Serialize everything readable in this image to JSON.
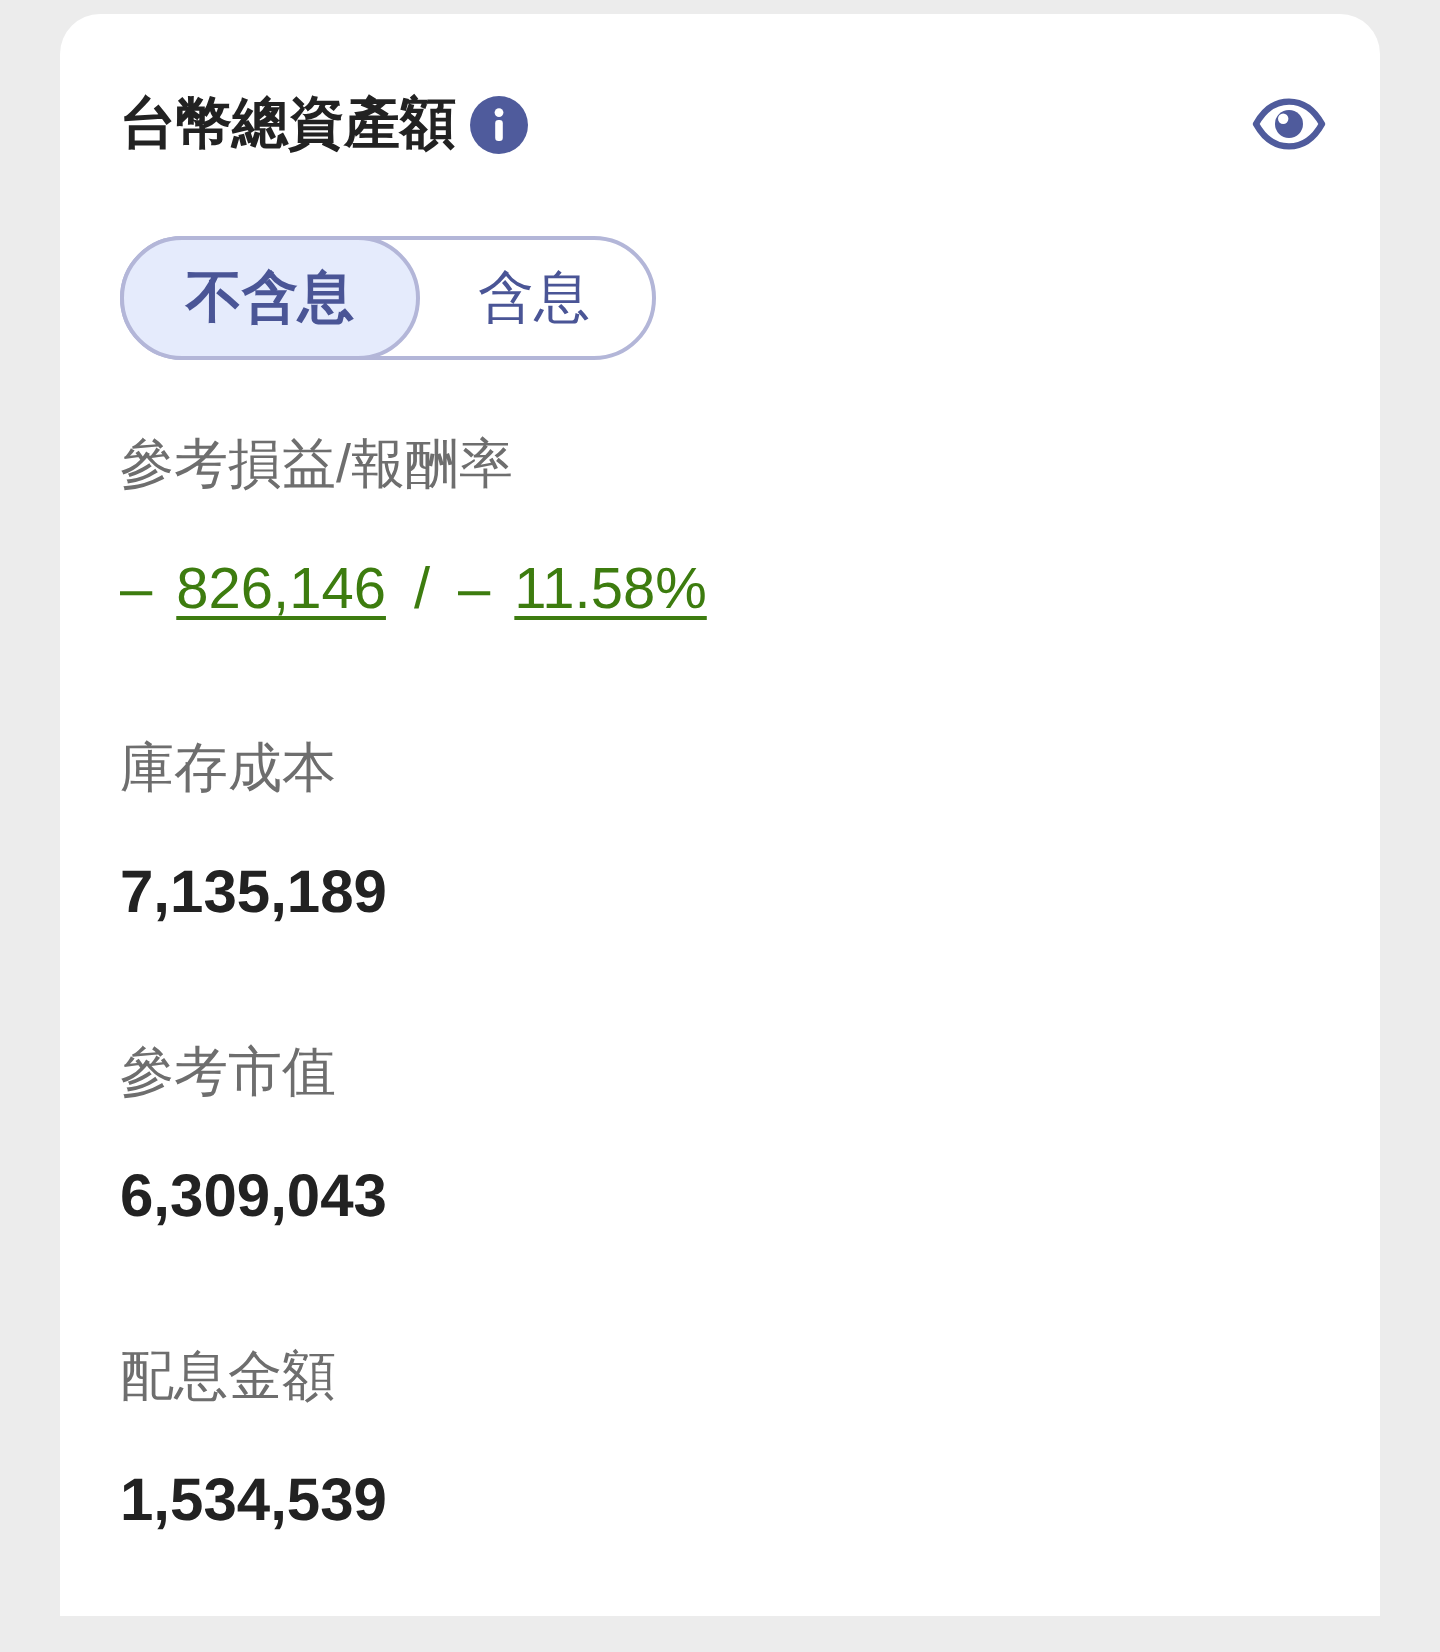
{
  "card": {
    "title": "台幣總資產額"
  },
  "toggle": [
    {
      "label": "不含息",
      "selected": true
    },
    {
      "label": "含息",
      "selected": false
    }
  ],
  "profit": {
    "label": "參考損益/報酬率",
    "amount_sign": "–",
    "amount": "826,146",
    "separator": "/",
    "rate_sign": "–",
    "rate": "11.58%"
  },
  "metrics": [
    {
      "label": "庫存成本",
      "value": "7,135,189"
    },
    {
      "label": "參考市值",
      "value": "6,309,043"
    },
    {
      "label": "配息金額",
      "value": "1,534,539"
    }
  ]
}
